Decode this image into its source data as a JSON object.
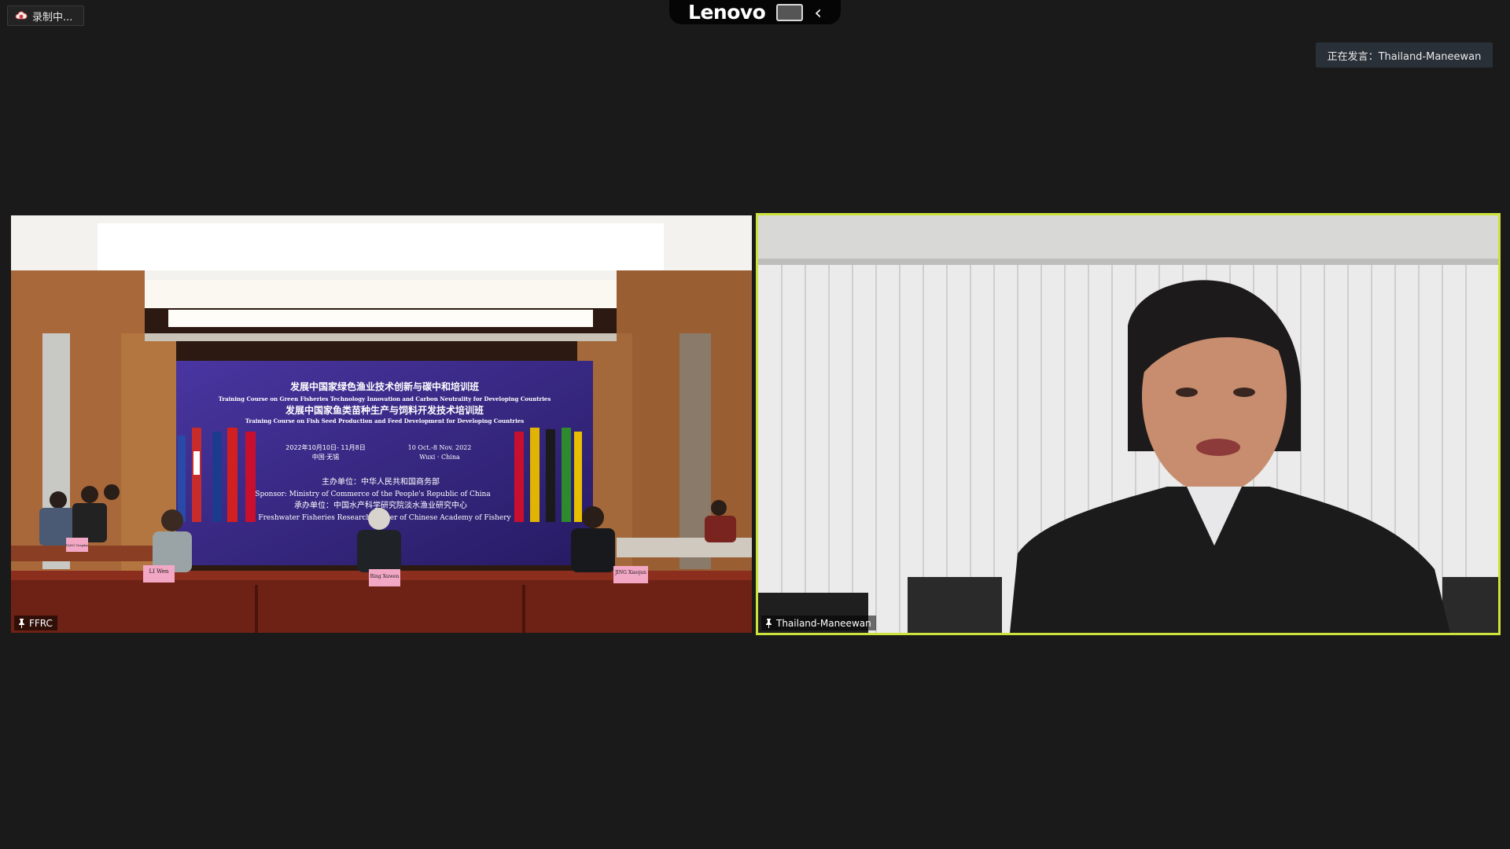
{
  "recording": {
    "label": "录制中..."
  },
  "brandbar": {
    "brand": "Lenovo",
    "chevron": "‹"
  },
  "speaking": {
    "label": "正在发言：Thailand-Maneewan"
  },
  "tiles": [
    {
      "name": "FFRC",
      "banner": {
        "title_cn_1": "发展中国家绿色渔业技术创新与碳中和培训班",
        "title_en_1": "Training Course on Green Fisheries Technology Innovation and Carbon Neutrality for Developing Countries",
        "title_cn_2": "发展中国家鱼类苗种生产与饲料开发技术培训班",
        "title_en_2": "Training Course on Fish Seed Production and Feed Development for Developing Countries",
        "date_cn": "2022年10月10日- 11月8日",
        "place_cn": "中国·无锡",
        "date_en": "10 Oct.-8 Nov. 2022",
        "place_en": "Wuxi · China",
        "sponsor_cn": "主办单位：中华人民共和国商务部",
        "sponsor_en": "Sponsor: Ministry of Commerce of the People's Republic of China",
        "organizer_cn": "承办单位：中国水产科学研究院淡水渔业研究中心",
        "organizer_en": "Freshwater Fisheries Research Center of Chinese Academy of Fishery"
      },
      "nameplates": {
        "li": "LI Wen",
        "bing": "Bing Xuwen",
        "jing": "JING Xiaojun",
        "tang": "TANG Yongkai"
      }
    },
    {
      "name": "Thailand-Maneewan"
    }
  ],
  "colors": {
    "active_border": "#cde23a",
    "background": "#1a1a1a"
  }
}
